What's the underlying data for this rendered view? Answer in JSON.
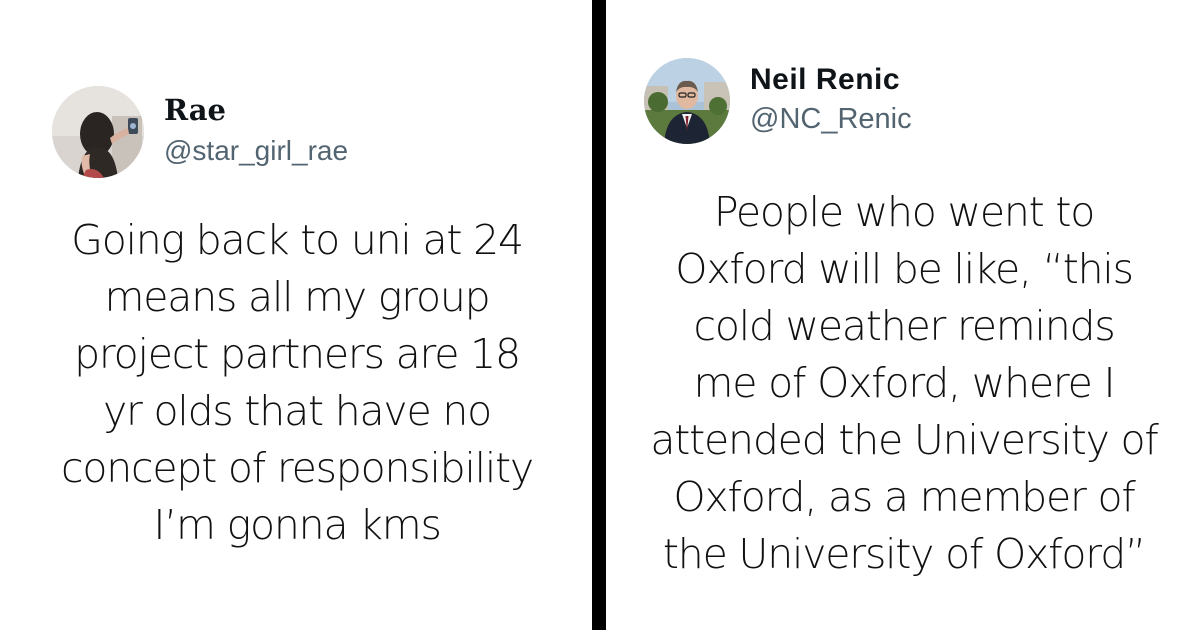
{
  "left_tweet": {
    "avatar_icon": "user-photo-avatar",
    "display_name": "Rae",
    "handle": "@star_girl_rae",
    "text": "Going back to uni at 24\nmeans all my group\nproject partners are 18\nyr olds that have no\nconcept of responsibility\nI’m gonna kms"
  },
  "right_tweet": {
    "avatar_icon": "user-photo-avatar",
    "display_name": "Neil Renic",
    "handle": "@NC_Renic",
    "text": "People who went to\nOxford will be like, “this\ncold weather reminds\nme of Oxford, where I\nattended the University of\nOxford, as a member of\nthe University of Oxford”"
  },
  "colors": {
    "divider": "#000000",
    "name": "#0f1419",
    "handle": "#536471",
    "text": "#111111",
    "background": "#ffffff"
  }
}
